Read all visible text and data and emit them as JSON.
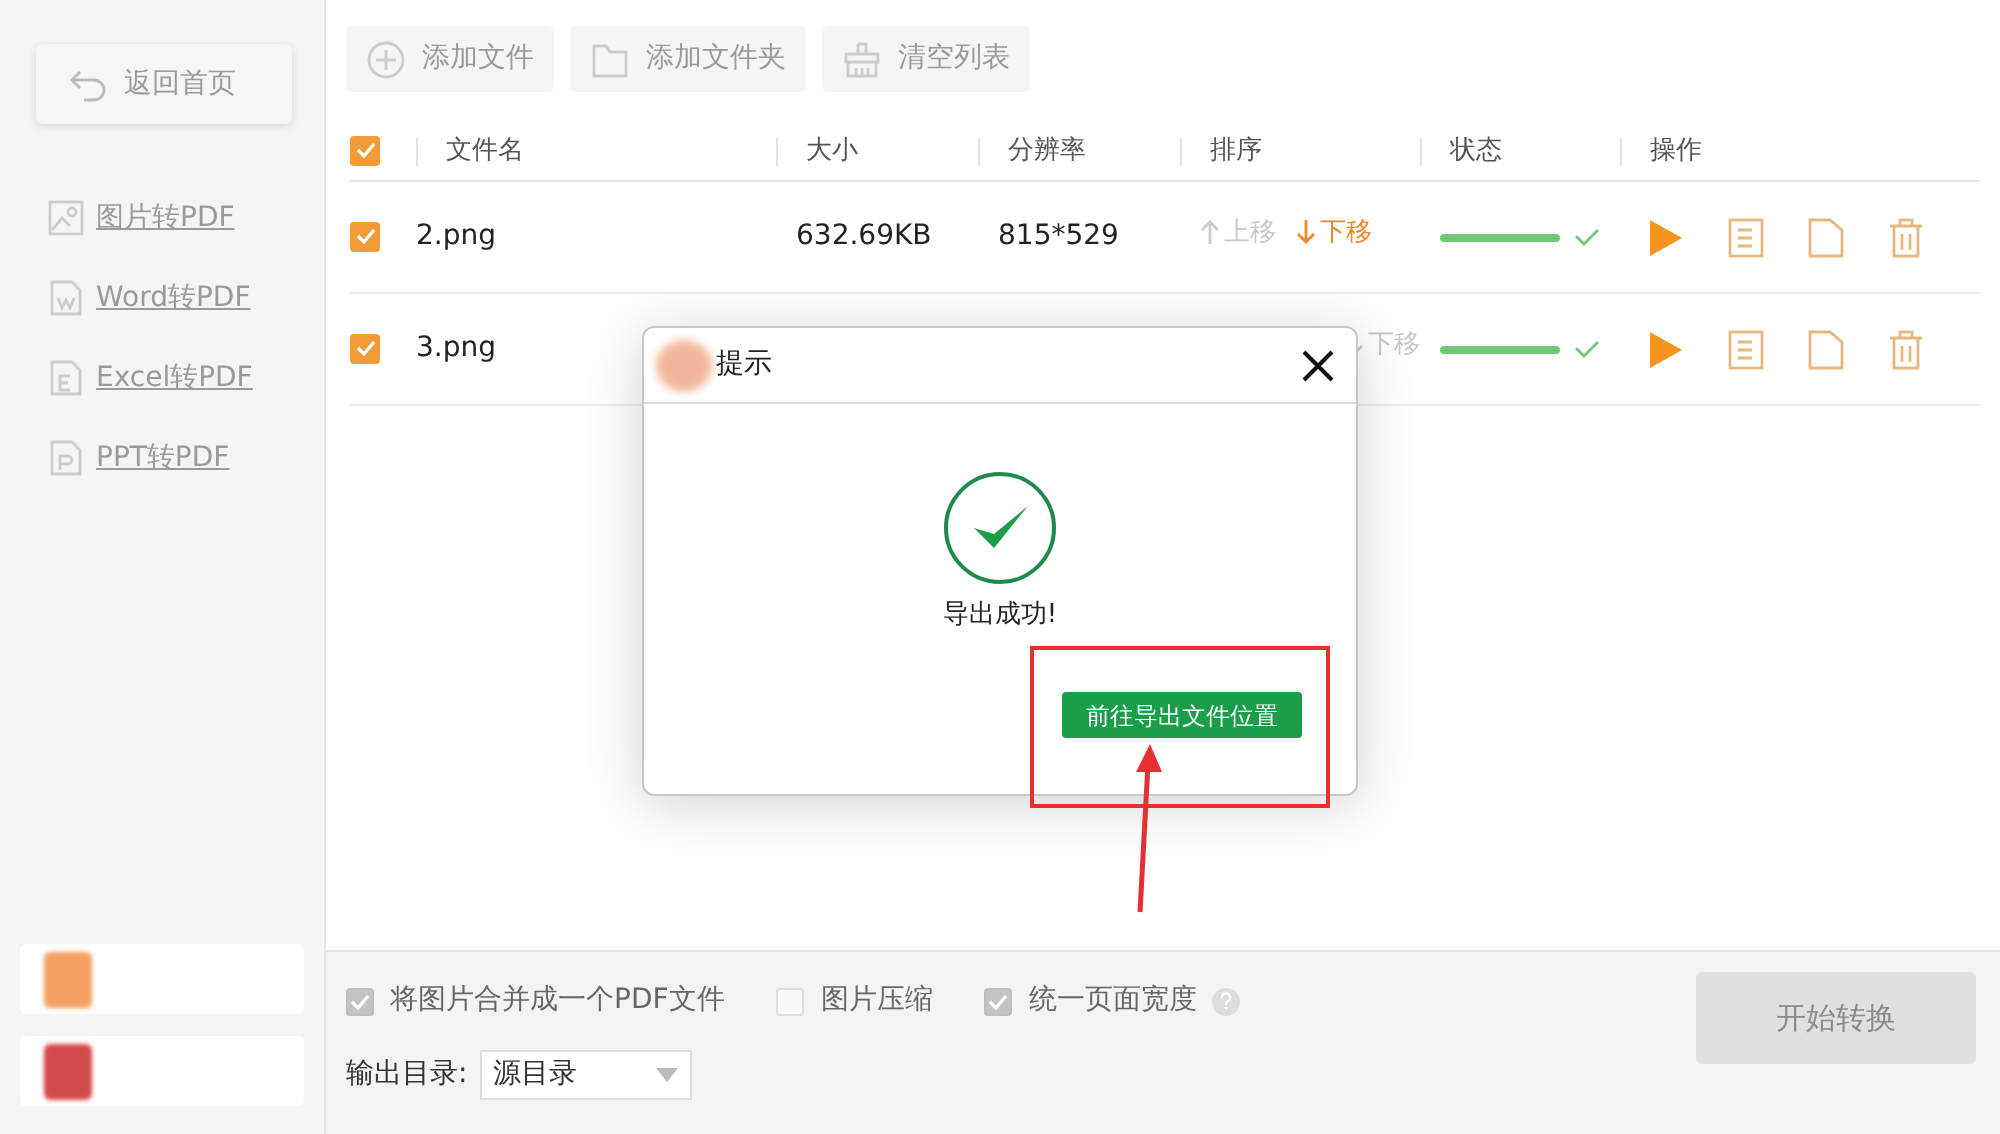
{
  "sidebar": {
    "back_button": {
      "label": "返回首页",
      "disabled": true
    },
    "items": [
      {
        "label": "图片转PDF",
        "kind": "image",
        "disabled": true
      },
      {
        "label": "Word转PDF",
        "kind": "word",
        "disabled": true
      },
      {
        "label": "Excel转PDF",
        "kind": "excel",
        "disabled": true
      },
      {
        "label": "PPT转PDF",
        "kind": "ppt",
        "disabled": true
      }
    ],
    "bottom_cards": [
      {
        "color": "#f4a060"
      },
      {
        "color": "#d24a4a"
      }
    ]
  },
  "toolbar": [
    {
      "label": "添加文件",
      "kind": "add",
      "disabled": true
    },
    {
      "label": "添加文件夹",
      "kind": "folder",
      "disabled": true
    },
    {
      "label": "清空列表",
      "kind": "clear",
      "disabled": true
    }
  ],
  "table": {
    "select_all": {
      "checked": true
    },
    "columns": [
      "文件名",
      "大小",
      "分辨率",
      "排序",
      "状态",
      "操作"
    ],
    "rows": [
      {
        "checked": true,
        "name": "2.png",
        "size": "632.69KB",
        "resolution": "815*529",
        "sort_up": {
          "label": "上移",
          "disabled": true
        },
        "sort_down": {
          "label": "下移",
          "disabled": false
        },
        "level": 1,
        "done": true
      },
      {
        "checked": true,
        "name": "3.png",
        "sort_down": {
          "label": "下移",
          "disabled": true
        },
        "level": 1,
        "done": true
      }
    ]
  },
  "options": [
    {
      "label": "将图片合并成一个PDF文件",
      "checked": true
    },
    {
      "label": "图片压缩",
      "checked": false
    },
    {
      "label": "统一页面宽度",
      "checked": true,
      "help": true
    }
  ],
  "output": {
    "label": "输出目录:",
    "value": "源目录"
  },
  "start_button": {
    "label": "开始转换",
    "disabled": true
  },
  "dialog": {
    "title": "提示",
    "message": "导出成功!",
    "button": "前往导出文件位置",
    "highlighted": true
  }
}
